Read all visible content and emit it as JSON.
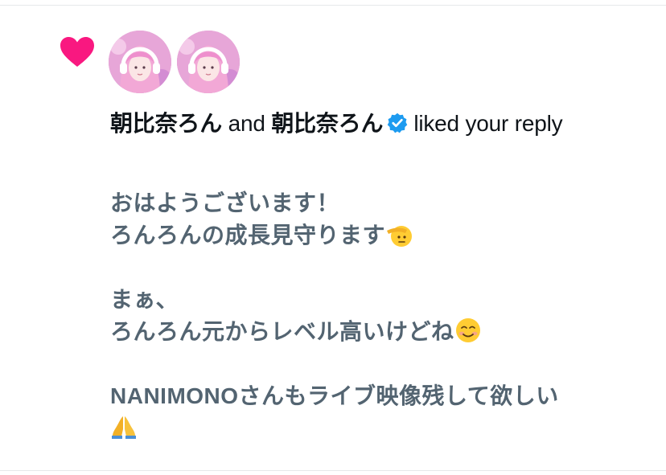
{
  "notification": {
    "type": "like",
    "heart_icon": "heart-icon",
    "avatars": [
      {
        "alt": "朝比奈ろん avatar"
      },
      {
        "alt": "朝比奈ろん avatar"
      }
    ],
    "users": [
      "朝比奈ろん",
      "朝比奈ろん"
    ],
    "connector": "and",
    "action_text": "liked your",
    "action_text_2": "reply",
    "verified_icon": "verified-badge-icon"
  },
  "reply": {
    "lines": [
      "おはようございます！",
      "ろんろんの成長見守ります",
      "",
      "まぁ、",
      "ろんろん元からレベル高いけどね",
      "",
      "NANIMONOさんもライブ映像残して欲しい",
      ""
    ],
    "emojis": {
      "line2": "saluting-face-emoji",
      "line5": "smiling-face-emoji",
      "line8": "folded-hands-emoji"
    }
  },
  "colors": {
    "heart": "#f91880",
    "verified": "#1d9bf0",
    "primary_text": "#0f1419",
    "secondary_text": "#536471",
    "divider": "#e6e8ea"
  }
}
